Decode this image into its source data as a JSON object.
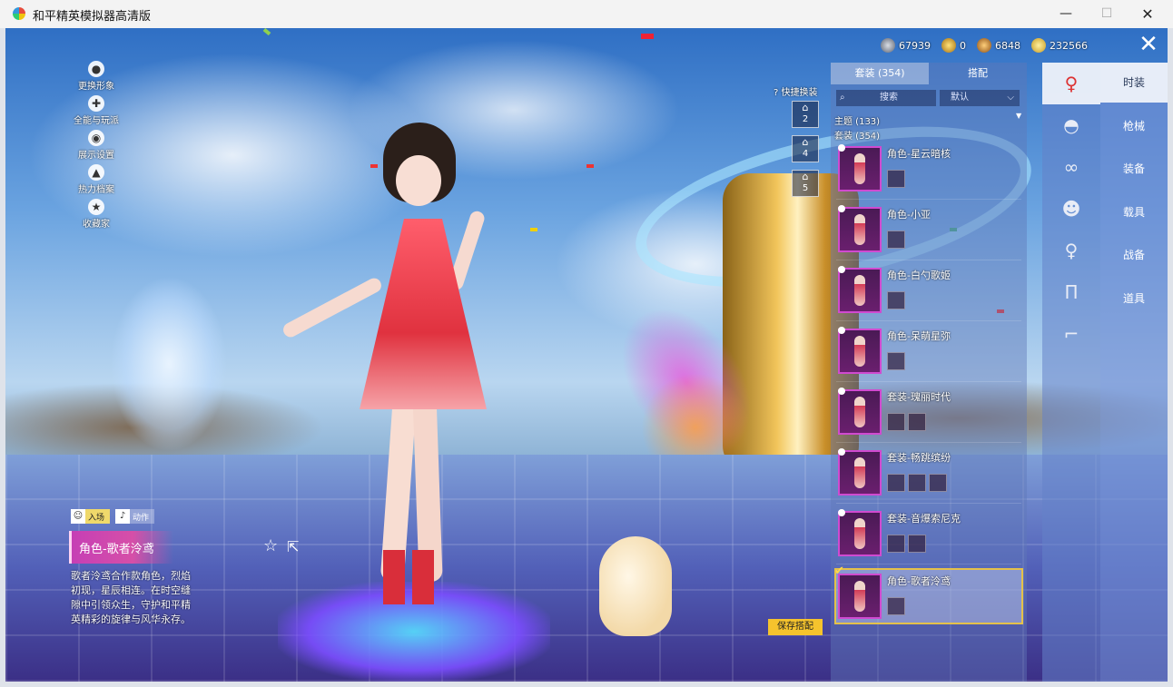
{
  "window": {
    "title": "和平精英模拟器高清版",
    "minimize": "—",
    "maximize": "☐",
    "close": "✕"
  },
  "currencies": [
    {
      "icon": "silver-medal-icon",
      "value": "67939"
    },
    {
      "icon": "gold-token-icon",
      "value": "0"
    },
    {
      "icon": "bronze-medal-icon",
      "value": "6848"
    },
    {
      "icon": "coin-icon",
      "value": "232566"
    }
  ],
  "close_glyph": "✕",
  "left_menu": [
    {
      "icon": "avatar-icon",
      "glyph": "●",
      "label": "更换形象"
    },
    {
      "icon": "puzzle-icon",
      "glyph": "✚",
      "label": "全能与玩派"
    },
    {
      "icon": "eye-icon",
      "glyph": "◉",
      "label": "展示设置"
    },
    {
      "icon": "flame-icon",
      "glyph": "▲",
      "label": "热力档案"
    },
    {
      "icon": "badge-icon",
      "glyph": "★",
      "label": "收藏家"
    }
  ],
  "mode_tabs": [
    {
      "label": "入场",
      "glyph": "☺"
    },
    {
      "label": "动作",
      "glyph": "♪"
    }
  ],
  "character": {
    "name": "角色-歌者泠鸢",
    "description": "歌者泠鸢合作款角色，烈焰初现，星辰相连。在时空缝隙中引领众生，守护和平精英精彩的旋律与风华永存。"
  },
  "actions": {
    "favorite": "☆",
    "share": "⇱"
  },
  "quick_swap": {
    "label": "快捷换装",
    "help": "?",
    "slots": [
      "2",
      "4",
      "5"
    ]
  },
  "panel": {
    "tabs": [
      {
        "label": "套装 (354)"
      },
      {
        "label": "搭配"
      }
    ],
    "search": {
      "icon": "⌕",
      "label": "搜索"
    },
    "sort": {
      "label": "默认",
      "chevron": "⌵"
    },
    "filters": [
      "主题 (133)",
      "套装 (354)"
    ],
    "filter_caret": "▼",
    "items": [
      {
        "name": "角色-星云暗核",
        "parts": 1
      },
      {
        "name": "角色-小亚",
        "parts": 1
      },
      {
        "name": "角色-白勺歌姬",
        "parts": 1
      },
      {
        "name": "角色-呆萌星弥",
        "parts": 1
      },
      {
        "name": "套装-瑰丽时代",
        "parts": 2
      },
      {
        "name": "套装-畅跳缤纷",
        "parts": 3
      },
      {
        "name": "套装-音爆索尼克",
        "parts": 2
      },
      {
        "name": "角色-歌者泠鸢",
        "parts": 1,
        "selected": true,
        "check": "✔"
      }
    ],
    "save_label": "保存搭配"
  },
  "icon_strip": [
    {
      "icon": "character-icon",
      "glyph": "♀",
      "active": true
    },
    {
      "icon": "helmet-icon",
      "glyph": "◓"
    },
    {
      "icon": "goggles-icon",
      "glyph": "∞"
    },
    {
      "icon": "mask-icon",
      "glyph": "☻"
    },
    {
      "icon": "outfit-icon",
      "glyph": "♀"
    },
    {
      "icon": "pants-icon",
      "glyph": "Π"
    },
    {
      "icon": "shoes-icon",
      "glyph": "⌐"
    }
  ],
  "categories": [
    {
      "label": "时装",
      "active": true
    },
    {
      "label": "枪械"
    },
    {
      "label": "装备"
    },
    {
      "label": "载具"
    },
    {
      "label": "战备"
    },
    {
      "label": "道具"
    }
  ],
  "colors": {
    "accent": "#f5c32d",
    "name_card": "#c63fb5",
    "selected_border": "#e4c14a"
  }
}
